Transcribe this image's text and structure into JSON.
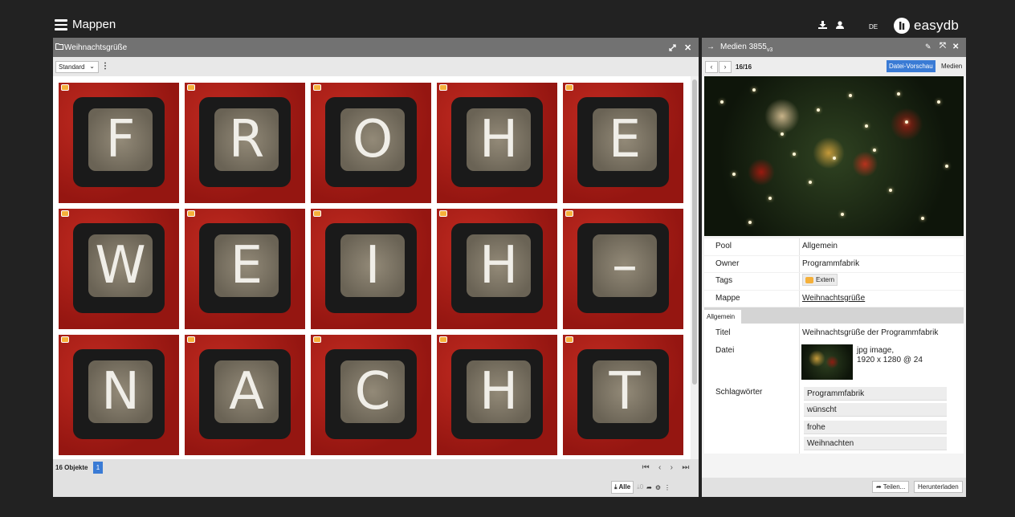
{
  "header": {
    "title": "Mappen",
    "language": "DE",
    "logo_text": "easydb"
  },
  "collection": {
    "title": "Weihnachtsgrüße",
    "view_select": "Standard",
    "tiles": [
      "F",
      "R",
      "O",
      "H",
      "E",
      "W",
      "E",
      "I",
      "H",
      "–",
      "N",
      "A",
      "C",
      "H",
      "T"
    ],
    "object_count": "16 Objekte",
    "page": "1",
    "download_all_label": "Alle",
    "download_count": "0"
  },
  "detail": {
    "title": "Medien 3855",
    "version": "v3",
    "position": "16/16",
    "tab_preview": "Datei-Vorschau",
    "tab_media": "Medien",
    "pool_label": "Pool",
    "pool_value": "Allgemein",
    "owner_label": "Owner",
    "owner_value": "Programmfabrik",
    "tags_label": "Tags",
    "tag_value": "Extern",
    "mappe_label": "Mappe",
    "mappe_value": "Weihnachtsgrüße",
    "section_tab": "Allgemein",
    "titel_label": "Titel",
    "titel_value": "Weihnachtsgrüße der Programmfabrik",
    "datei_label": "Datei",
    "datei_type": "jpg image,",
    "datei_size": "1920 x 1280 @ 24",
    "keywords_label": "Schlagwörter",
    "keywords": [
      "Programmfabrik",
      "wünscht",
      "frohe",
      "Weihnachten"
    ],
    "share_label": "Teilen...",
    "download_label": "Herunterladen"
  },
  "colors": {
    "accent": "#3a7bd5",
    "tag_orange": "#f5b03a",
    "tile_red": "#a51a16"
  }
}
